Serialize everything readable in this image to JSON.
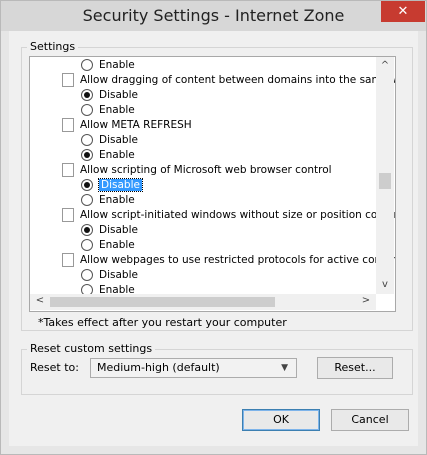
{
  "window": {
    "title": "Security Settings - Internet Zone",
    "close_glyph": "✕"
  },
  "settings": {
    "group_label": "Settings",
    "rows": [
      {
        "kind": "radio",
        "label": "Enable",
        "checked": false,
        "selected": false
      },
      {
        "kind": "header",
        "label": "Allow dragging of content between domains into the same wi"
      },
      {
        "kind": "radio",
        "label": "Disable",
        "checked": true,
        "selected": false
      },
      {
        "kind": "radio",
        "label": "Enable",
        "checked": false,
        "selected": false
      },
      {
        "kind": "header",
        "label": "Allow META REFRESH"
      },
      {
        "kind": "radio",
        "label": "Disable",
        "checked": false,
        "selected": false
      },
      {
        "kind": "radio",
        "label": "Enable",
        "checked": true,
        "selected": false
      },
      {
        "kind": "header",
        "label": "Allow scripting of Microsoft web browser control"
      },
      {
        "kind": "radio",
        "label": "Disable",
        "checked": true,
        "selected": true
      },
      {
        "kind": "radio",
        "label": "Enable",
        "checked": false,
        "selected": false
      },
      {
        "kind": "header",
        "label": "Allow script-initiated windows without size or position constra"
      },
      {
        "kind": "radio",
        "label": "Disable",
        "checked": true,
        "selected": false
      },
      {
        "kind": "radio",
        "label": "Enable",
        "checked": false,
        "selected": false
      },
      {
        "kind": "header",
        "label": "Allow webpages to use restricted protocols for active conten"
      },
      {
        "kind": "radio",
        "label": "Disable",
        "checked": false,
        "selected": false
      },
      {
        "kind": "radio",
        "label": "Enable",
        "checked": false,
        "selected": false
      }
    ],
    "note": "*Takes effect after you restart your computer"
  },
  "reset": {
    "group_label": "Reset custom settings",
    "label": "Reset to:",
    "value": "Medium-high (default)",
    "button": "Reset..."
  },
  "footer": {
    "ok": "OK",
    "cancel": "Cancel"
  },
  "scroll": {
    "up": "^",
    "down": "v",
    "left": "<",
    "right": ">"
  }
}
